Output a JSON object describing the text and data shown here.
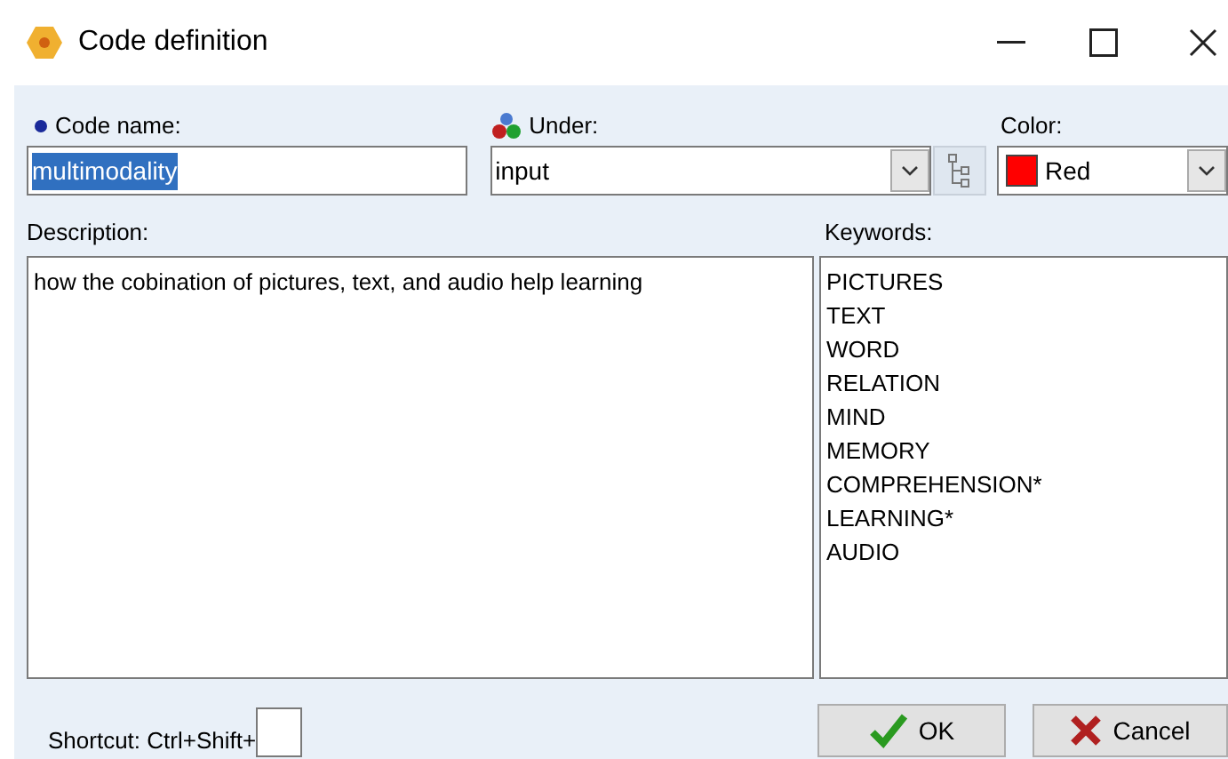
{
  "window": {
    "title": "Code definition"
  },
  "code_name": {
    "label": "Code name:",
    "value": "multimodality",
    "text_selected": true
  },
  "under": {
    "label": "Under:",
    "value": "input"
  },
  "color": {
    "label": "Color:",
    "value": "Red",
    "color": "#ff0000"
  },
  "description": {
    "label": "Description:",
    "value": "how the cobination of pictures, text, and audio help learning"
  },
  "keywords": {
    "label": "Keywords:",
    "items": [
      "PICTURES",
      "TEXT",
      "WORD",
      "RELATION",
      "MIND",
      "MEMORY",
      "COMPREHENSION*",
      "LEARNING*",
      "AUDIO"
    ]
  },
  "shortcut": {
    "label": "Shortcut: Ctrl+Shift+"
  },
  "buttons": [
    {
      "kind": "ok",
      "label": "OK"
    },
    {
      "kind": "cancel",
      "label": "Cancel"
    }
  ]
}
